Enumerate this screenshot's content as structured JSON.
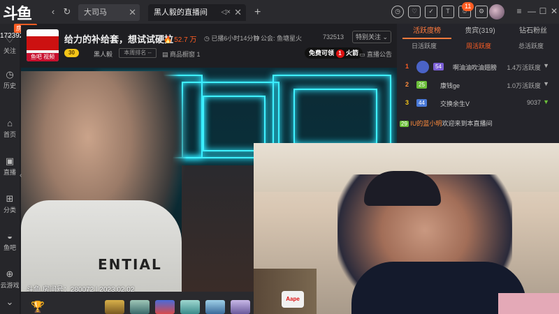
{
  "brand": {
    "logo_text": "斗鱼",
    "room_tag": "房间号",
    "room_number": "172392"
  },
  "tabs": [
    {
      "label": "大司马"
    },
    {
      "label": "黑人毅的直播间"
    }
  ],
  "toolbar": {
    "notify_badge": "11"
  },
  "sidebar": {
    "items": [
      {
        "label": "关注",
        "icon": "heart-icon"
      },
      {
        "label": "历史",
        "icon": "clock-icon"
      },
      {
        "label": "首页",
        "icon": "home-icon"
      },
      {
        "label": "直播",
        "icon": "tv-icon"
      },
      {
        "label": "分类",
        "icon": "grid-icon"
      },
      {
        "label": "鱼吧",
        "icon": "fish-icon"
      },
      {
        "label": "云游戏",
        "icon": "gamepad-icon"
      }
    ]
  },
  "header": {
    "avatar_label": "鱼吧 视频",
    "title": "给力的补给套，想试试硬拉",
    "hot": "52.7 万",
    "live_time": "已播6小时14分钟",
    "announcement": "公会: 鱼塘星火",
    "room_id": "732513",
    "follow_label": "特别关注",
    "level": "30",
    "anchor_name": "黑人毅",
    "rank_label": "本周排名 --",
    "shop_label": "商品橱窗 1",
    "free_banner_pre": "免费可领",
    "free_banner_num": "1",
    "free_banner_post": "火箭",
    "notice_label": "直播公告"
  },
  "video": {
    "sweater_text": "ENTIAL",
    "watermark": "斗鱼 房间号：280072 | 2023.02.02"
  },
  "pip": {
    "cushion_text": "Aape"
  },
  "rank_panel": {
    "tabs": [
      "活跃度榜",
      "贵宾(319)",
      "钻石粉丝"
    ],
    "subtabs": [
      "日活跃度",
      "周活跃度",
      "总活跃度"
    ],
    "rows": [
      {
        "rank": "1",
        "level": "54",
        "name": "啊油油吹油翅膀",
        "score": "1.4万活跃度",
        "trend": "▼"
      },
      {
        "rank": "2",
        "level": "25",
        "name": "康钱ge",
        "score": "1.0万活跃度",
        "trend": "▼"
      },
      {
        "rank": "3",
        "level": "44",
        "name": "交换余生V",
        "score": "9037",
        "trend": "▼"
      }
    ]
  },
  "chat": {
    "badge": "29",
    "user": "IU的蓝小明",
    "message": "欢迎来到本直播间"
  },
  "colors": {
    "accent": "#ff5d23",
    "panel_bg": "#24242a",
    "neon": "#3ff0ff"
  }
}
